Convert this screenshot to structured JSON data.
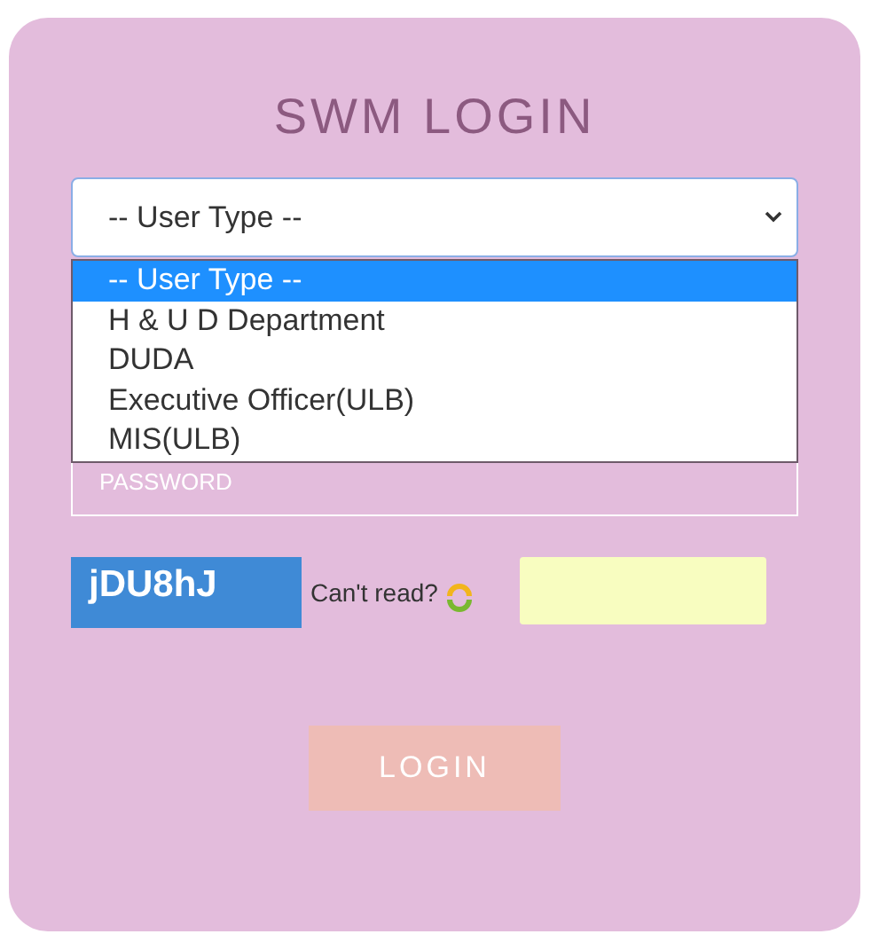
{
  "title": "SWM LOGIN",
  "user_type_select": {
    "value": "-- User Type --",
    "expanded": true,
    "options": [
      {
        "label": "-- User Type --",
        "selected": true
      },
      {
        "label": "H & U D Department",
        "selected": false
      },
      {
        "label": "DUDA",
        "selected": false
      },
      {
        "label": "Executive Officer(ULB)",
        "selected": false
      },
      {
        "label": "MIS(ULB)",
        "selected": false
      }
    ]
  },
  "password": {
    "placeholder": "PASSWORD"
  },
  "captcha": {
    "code": "jDU8hJ",
    "refresh_label": "Can't read?"
  },
  "login_button": "LOGIN"
}
